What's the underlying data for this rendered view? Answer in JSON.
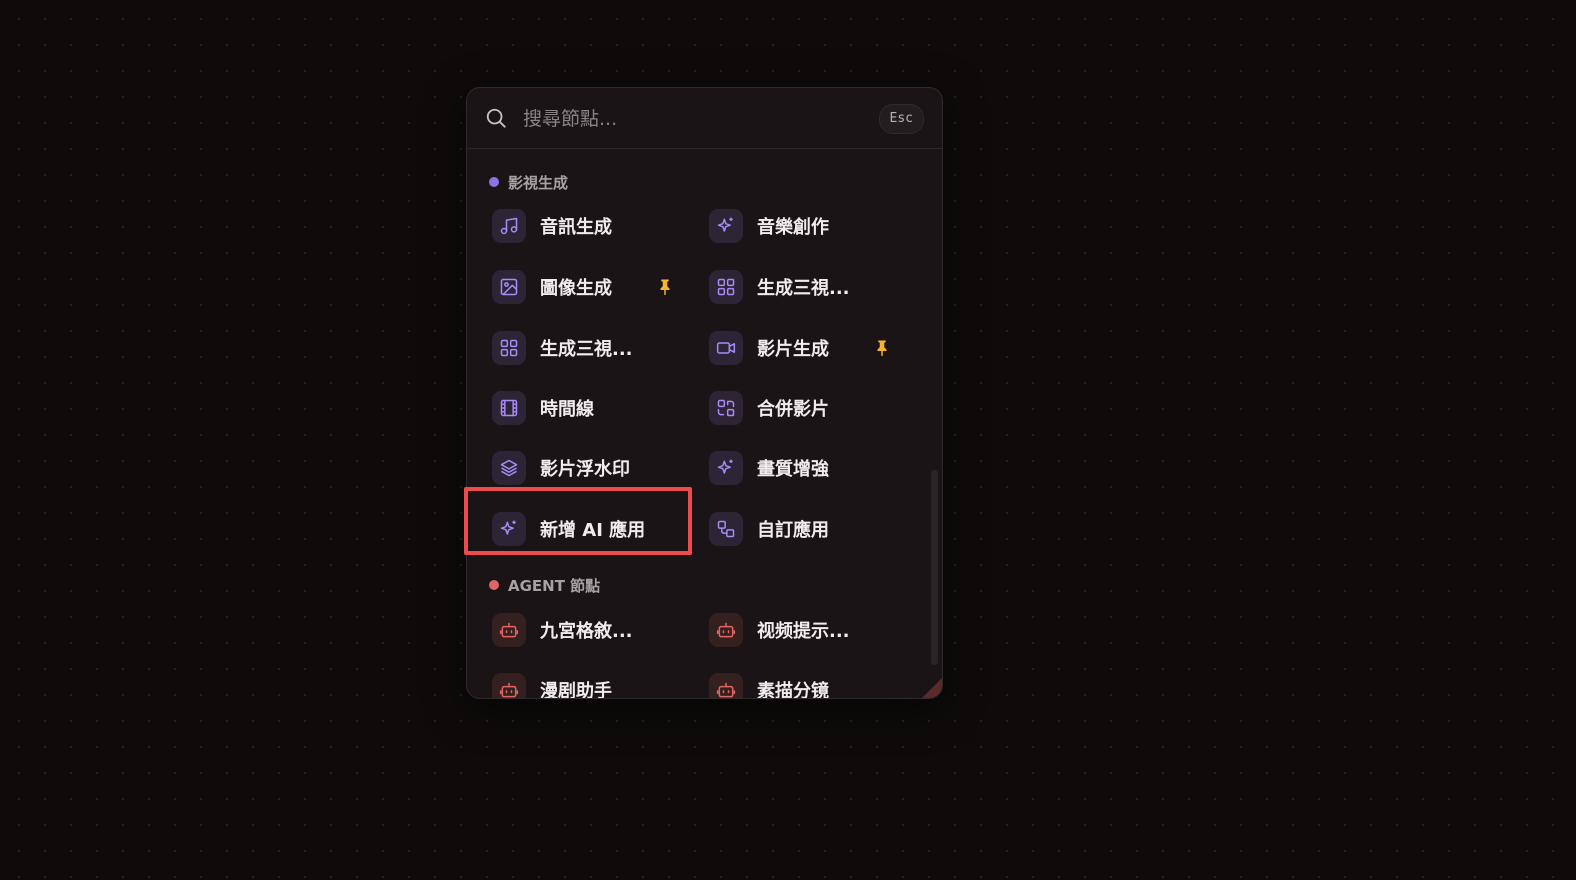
{
  "search": {
    "placeholder": "搜尋節點...",
    "esc_label": "Esc"
  },
  "sections": [
    {
      "title": "影視生成",
      "dot_color": "#8b74e6",
      "items": [
        {
          "label": "音訊生成",
          "icon": "music-note-icon"
        },
        {
          "label": "音樂創作",
          "icon": "sparkle-icon"
        },
        {
          "label": "圖像生成",
          "icon": "image-icon",
          "pinned": true
        },
        {
          "label": "生成三視...",
          "icon": "grid-icon"
        },
        {
          "label": "生成三視...",
          "icon": "grid-icon"
        },
        {
          "label": "影片生成",
          "icon": "video-camera-icon",
          "pinned": true
        },
        {
          "label": "時間線",
          "icon": "film-strip-icon"
        },
        {
          "label": "合併影片",
          "icon": "merge-icon"
        },
        {
          "label": "影片浮水印",
          "icon": "layers-icon"
        },
        {
          "label": "畫質增強",
          "icon": "sparkle-icon"
        },
        {
          "label": "新增 AI 應用",
          "icon": "sparkle-icon",
          "highlighted": true
        },
        {
          "label": "自訂應用",
          "icon": "workflow-icon"
        }
      ]
    },
    {
      "title": "AGENT 節點",
      "dot_color": "#e06666",
      "items": [
        {
          "label": "九宮格敘...",
          "icon": "robot-icon"
        },
        {
          "label": "视频提示...",
          "icon": "robot-icon"
        },
        {
          "label": "漫剧助手",
          "icon": "robot-icon"
        },
        {
          "label": "素描分镜",
          "icon": "robot-icon"
        }
      ]
    }
  ],
  "colors": {
    "accent_purple": "#8b74e6",
    "accent_red": "#e06666",
    "pin_yellow": "#f5b52e",
    "highlight_red": "#ef4b4f"
  }
}
